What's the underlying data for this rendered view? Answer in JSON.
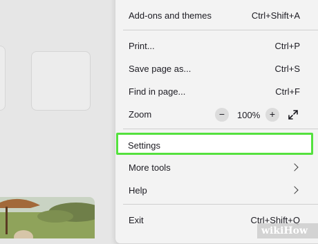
{
  "menu": {
    "addons": {
      "label": "Add-ons and themes",
      "shortcut": "Ctrl+Shift+A"
    },
    "print": {
      "label": "Print...",
      "shortcut": "Ctrl+P"
    },
    "save_page": {
      "label": "Save page as...",
      "shortcut": "Ctrl+S"
    },
    "find": {
      "label": "Find in page...",
      "shortcut": "Ctrl+F"
    },
    "zoom": {
      "label": "Zoom",
      "minus": "−",
      "value": "100%",
      "plus": "+"
    },
    "settings": {
      "label": "Settings"
    },
    "more_tools": {
      "label": "More tools"
    },
    "help": {
      "label": "Help"
    },
    "exit": {
      "label": "Exit",
      "shortcut": "Ctrl+Shift+Q"
    }
  },
  "watermark": {
    "text": "wikiHow"
  },
  "colors": {
    "highlight": "#54e13e",
    "menu_background": "#f3f3f3",
    "page_background": "#e6e6e6"
  },
  "icons": {
    "fullscreen": "fullscreen-icon",
    "submenu_arrow": "chevron-right-icon"
  }
}
